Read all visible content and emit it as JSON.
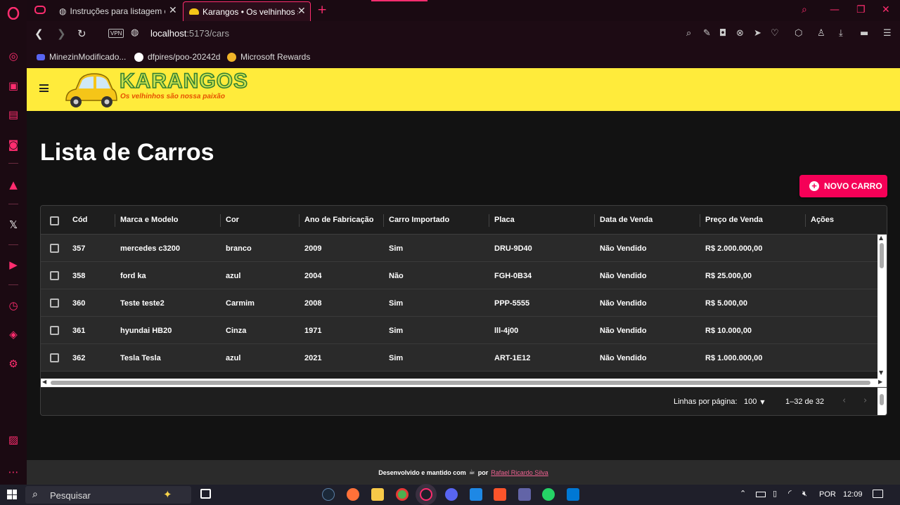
{
  "browser": {
    "tabs": [
      {
        "label": "Instruções para listagem ca"
      },
      {
        "label": "Karangos • Os velhinhos sã"
      }
    ],
    "url_host": "localhost",
    "url_path": ":5173/cars",
    "vpn_label": "VPN",
    "bookmarks": [
      "MinezinModificado...",
      "dfpires/poo-20242d",
      "Microsoft Rewards"
    ]
  },
  "header": {
    "logo_title": "KARANGOS",
    "logo_tagline": "Os velhinhos são nossa paixão"
  },
  "main": {
    "title": "Lista de Carros",
    "new_car_label": "NOVO CARRO"
  },
  "grid": {
    "columns": [
      "Cód",
      "Marca e Modelo",
      "Cor",
      "Ano de Fabricação",
      "Carro Importado",
      "Placa",
      "Data de Venda",
      "Preço de Venda",
      "Ações"
    ],
    "rows": [
      [
        "357",
        "mercedes c3200",
        "branco",
        "2009",
        "Sim",
        "DRU-9D40",
        "Não Vendido",
        "R$ 2.000.000,00"
      ],
      [
        "358",
        "ford ka",
        "azul",
        "2004",
        "Não",
        "FGH-0B34",
        "Não Vendido",
        "R$ 25.000,00"
      ],
      [
        "360",
        "Teste teste2",
        "Carmim",
        "2008",
        "Sim",
        "PPP-5555",
        "Não Vendido",
        "R$ 5.000,00"
      ],
      [
        "361",
        "hyundai HB20",
        "Cinza",
        "1971",
        "Sim",
        "lll-4j00",
        "Não Vendido",
        "R$ 10.000,00"
      ],
      [
        "362",
        "Tesla Tesla",
        "azul",
        "2021",
        "Sim",
        "ART-1E12",
        "Não Vendido",
        "R$ 1.000.000,00"
      ]
    ],
    "rows_per_page_label": "Linhas por página:",
    "rows_per_page_value": "100",
    "range_label": "1–32 de 32"
  },
  "footer": {
    "text": "Desenvolvido e mantido com",
    "by": "por",
    "author": "Rafael Ricardo Silva"
  },
  "taskbar": {
    "search_placeholder": "Pesquisar",
    "language": "POR",
    "time": "12:09"
  },
  "colors": {
    "accent": "#f50057",
    "header_bg": "#ffeb3b",
    "opera_red": "#ff2d6f"
  }
}
